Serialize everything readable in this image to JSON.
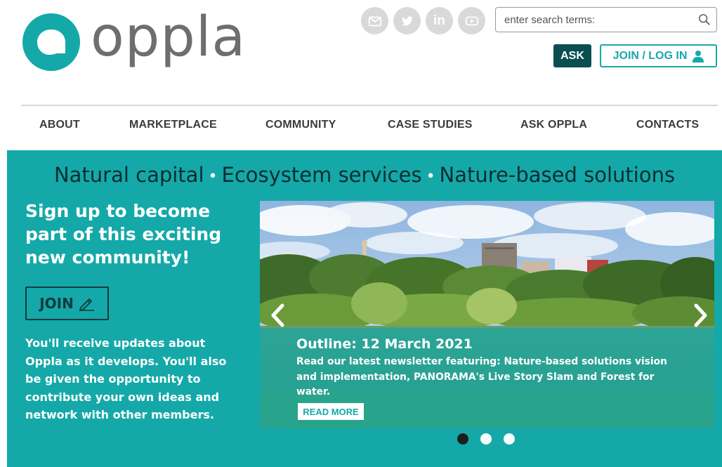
{
  "brand": {
    "logo_text": "oppla",
    "accent_color": "#14a9a8",
    "dark_color": "#0a4e52"
  },
  "social": [
    {
      "icon": "email-icon",
      "label": ""
    },
    {
      "icon": "twitter-icon",
      "label": ""
    },
    {
      "icon": "linkedin-icon",
      "label": "in"
    },
    {
      "icon": "youtube-icon",
      "label": ""
    }
  ],
  "search": {
    "placeholder": "enter search terms:",
    "value": ""
  },
  "header": {
    "ask_label": "ASK",
    "join_login_label": "JOIN / LOG IN"
  },
  "nav": {
    "items": [
      {
        "label": "ABOUT"
      },
      {
        "label": "MARKETPLACE"
      },
      {
        "label": "COMMUNITY"
      },
      {
        "label": "CASE STUDIES"
      },
      {
        "label": "ASK OPPLA"
      },
      {
        "label": "CONTACTS"
      }
    ]
  },
  "hero": {
    "tagline": {
      "part1": "Natural capital",
      "part2": "Ecosystem services",
      "part3": "Nature-based solutions",
      "separator": "•"
    },
    "signup_title": "Sign up to become part of this exciting new community!",
    "join_label": "JOIN",
    "signup_text": "You'll receive updates about Oppla as it develops. You'll also be given the opportunity to contribute your own ideas and network with other members."
  },
  "slider": {
    "title": "Outline: 12 March 2021",
    "text": "Read our latest newsletter featuring: Nature-based solutions vision and implementation, PANORAMA's Live Story Slam and Forest for water.",
    "read_more_label": "READ MORE",
    "current_slide": 1,
    "slide_count": 3
  }
}
